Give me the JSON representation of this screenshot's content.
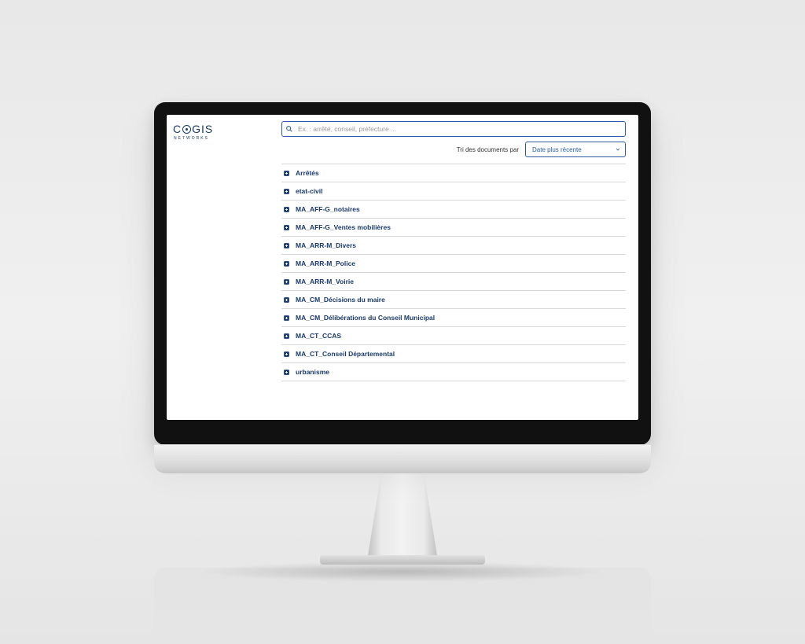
{
  "logo": {
    "name_prefix": "C",
    "name_suffix": "GIS",
    "subtitle": "NETWORKS"
  },
  "search": {
    "placeholder": "Ex. : arrêté, conseil, préfecture ..."
  },
  "sort": {
    "label": "Tri des documents par",
    "selected": "Date plus récente"
  },
  "categories": [
    {
      "label": "Arrêtés"
    },
    {
      "label": "etat-civil"
    },
    {
      "label": "MA_AFF-G_notaires"
    },
    {
      "label": "MA_AFF-G_Ventes mobilières"
    },
    {
      "label": "MA_ARR-M_Divers"
    },
    {
      "label": "MA_ARR-M_Police"
    },
    {
      "label": "MA_ARR-M_Voirie"
    },
    {
      "label": "MA_CM_Décisions du maire"
    },
    {
      "label": "MA_CM_Délibérations du Conseil Municipal"
    },
    {
      "label": "MA_CT_CCAS"
    },
    {
      "label": "MA_CT_Conseil Départemental"
    },
    {
      "label": "urbanisme"
    }
  ]
}
